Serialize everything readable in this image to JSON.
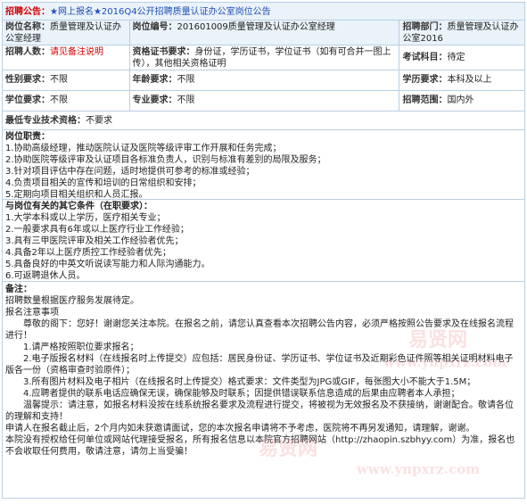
{
  "header": {
    "label": "招聘公告：",
    "title": "★网上报名★2016Q4公开招聘质量认证办公室岗位公告"
  },
  "row1": {
    "post_name_label": "岗位名称：",
    "post_name_value": "质量管理及认证办公室经理",
    "post_code_label": "岗位编号：",
    "post_code_value": "201601009质量管理及认证办公室经理",
    "dept_label": "招聘部门：",
    "dept_value": "质量管理及认证办公室2016"
  },
  "row2": {
    "count_label": "招聘人数：",
    "count_value": "请见备注说明",
    "cert_label": "资格证书要求：",
    "cert_value": "身份证，学历证书，学位证书（如有可合并一图上传），其他相关资格证明",
    "exam_label": "考试科目：",
    "exam_value": "待定"
  },
  "row3": {
    "gender_label": "性别要求：",
    "gender_value": "不限",
    "age_label": "年龄要求：",
    "age_value": "不限",
    "edu_label": "学历要求：",
    "edu_value": "本科及以上"
  },
  "row4": {
    "degree_label": "学位要求：",
    "degree_value": "不限",
    "major_label": "专业要求：",
    "major_value": "不限",
    "range_label": "招聘范围：",
    "range_value": "国内外"
  },
  "row5": {
    "tech_label": "最低专业技术资格：",
    "tech_value": "不要求"
  },
  "duties": {
    "title": "岗位职责：",
    "items": [
      "1.协助高级经理，推动医院认证及医院等级评审工作开展和任务完成；",
      "2.协助医院等级评审及认证项目各标准负责人，识别与标准有差别的局限及服务；",
      "3.针对项目评估中存在问题，适时地提供可参考的标准或经验；",
      "4.负责项目相关的宣传和培训的日常组织和安排；",
      "5.定期向项目相关组织和人员汇报。"
    ]
  },
  "conditions": {
    "title": "与岗位有关的其它条件（在职要求）：",
    "items": [
      "1.大学本科或以上学历，医疗相关专业；",
      "2.一般要求具有6年或以上医疗行业工作经验；",
      "3.具有三甲医院评审及相关工作经验者优先；",
      "4.具备2年以上医疗质控工作经验者优先；",
      "5.具备良好的中英文听说读写能力和人际沟通能力。",
      "6.可返聘退休人员。"
    ]
  },
  "notes": {
    "title": "备注：",
    "line1": "招聘数量根据医疗服务发展待定。",
    "line2": "报名注意事项",
    "para1": "尊敬的阁下：您好！谢谢您关注本院。在报名之前，请您认真查看本次招聘公告内容，必须严格按照公告要求及在线报名流程进行！",
    "item1": "1.请严格按照职位要求报名；",
    "item2": "2.电子版报名材料（在线报名时上传提交）应包括：居民身份证、学历证书、学位证书及近期彩色证件照等相关证明材料电子版各一份（资格审查时验原件）；",
    "item3": "3.所有图片材料及电子相片（在线报名时上传提交）格式要求：文件类型为JPG或GIF，每张图大小不能大于1.5M；",
    "item4": "4.应聘者提供的联系电话应确保无误，确保能够及时联系；因提供错误联系信息造成的后果由应聘者本人承担；",
    "para2": "温馨提示：请注意，如报名材料没按在线系统报名要求及流程进行提交，将被视为无效报名及不获接纳，谢谢配合。敬请各位的理解和支持！",
    "para3": "申请人在报名截止后，2个月内如未获邀请面试，您的本次报名申请将不予考虑，医院将不再另发通知，请理解，谢谢。",
    "para4": "本院没有授权给任何单位或网站代理接受报名，所有报名信息以本院官方招聘网站（http://zhaopin.szbhyy.com）为准，报名也不会收取任何费用，敬请注意，请勿上当受骗！"
  },
  "watermark": {
    "text1": "易贤网",
    "text2": "www.ynpxrz.com"
  }
}
